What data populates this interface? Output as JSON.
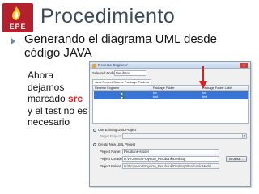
{
  "logo": {
    "text": "EPE",
    "brand_color": "#b3202e"
  },
  "slide": {
    "title": "Procedimiento",
    "bullet": "Generando el diagrama UML desde código JAVA",
    "note_before": "Ahora dejamos marcado ",
    "note_highlight": "src",
    "note_after": " y el test no es necesario",
    "highlight_color": "#e02020"
  },
  "dialog": {
    "title": "Reverse Engineer",
    "close_label": "x",
    "selected_nodes_label": "Selected Nodes:",
    "selected_nodes_value": "Perubank",
    "tabs": [
      {
        "label": "Java Project Source Package Folders",
        "active": true
      }
    ],
    "table": {
      "columns": [
        "Reverse Engineer",
        "Package Folder",
        "Package Folder Label"
      ],
      "rows": [
        {
          "folder": "src",
          "label": "src",
          "checked": true,
          "selected": true
        },
        {
          "folder": "test",
          "label": "test",
          "checked": false,
          "selected": true
        }
      ]
    },
    "option_existing": "Use Existing UML Project",
    "target_project_label": "Target Project:",
    "option_new": "Create New UML Project",
    "project_name_label": "Project Name:",
    "project_name_value": "Perubank-Model",
    "project_location_label": "Project Location:",
    "project_location_value": "D:\\Proyecto\\Proyecto_Perubank\\Desktop",
    "browse_label": "Browse...",
    "project_folder_label": "Project Folder:",
    "project_folder_value": "D:\\Proyecto\\Proyecto_Perubank\\Desktop\\Perubank-Model"
  }
}
